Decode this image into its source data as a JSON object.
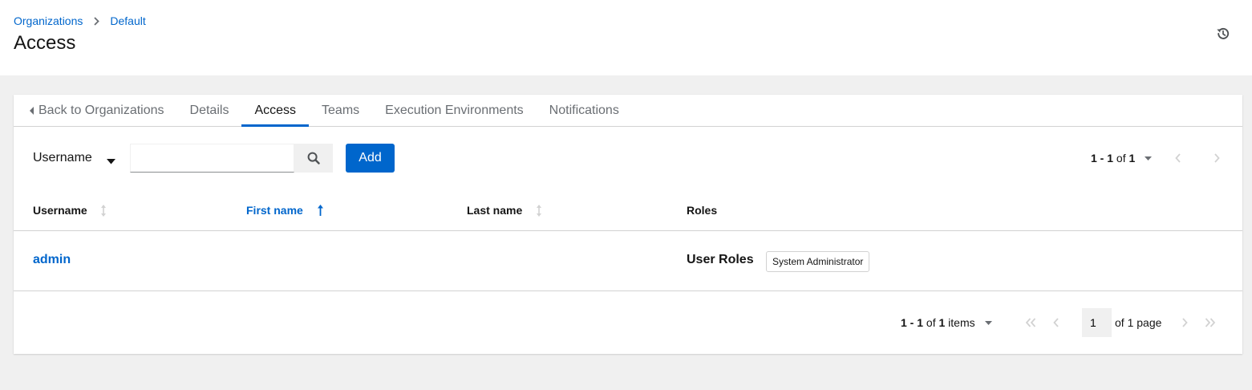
{
  "breadcrumb": [
    {
      "label": "Organizations"
    },
    {
      "label": "Default"
    }
  ],
  "page_title": "Access",
  "tabs": [
    {
      "label": "Back to Organizations"
    },
    {
      "label": "Details"
    },
    {
      "label": "Access"
    },
    {
      "label": "Teams"
    },
    {
      "label": "Execution Environments"
    },
    {
      "label": "Notifications"
    }
  ],
  "active_tab": "Access",
  "toolbar": {
    "filter_field": "Username",
    "search_value": "",
    "add_label": "Add"
  },
  "pagination_top": {
    "range": "1 - 1",
    "of": "of",
    "total": "1"
  },
  "table": {
    "columns": [
      {
        "label": "Username"
      },
      {
        "label": "First name"
      },
      {
        "label": "Last name"
      },
      {
        "label": "Roles"
      }
    ],
    "sorted_column": "First name",
    "rows": [
      {
        "username": "admin",
        "first_name": "",
        "last_name": "",
        "roles_label": "User Roles",
        "roles": [
          "System Administrator"
        ]
      }
    ]
  },
  "pagination_bottom": {
    "range": "1 - 1",
    "of": "of",
    "total": "1",
    "items_word": "items",
    "page_value": "1",
    "of_word": "of",
    "page_total": "1",
    "page_word": "page"
  },
  "colors": {
    "link": "#0066cc",
    "primary_button": "#0066cc",
    "muted_icon": "#d2d2d2",
    "page_bg": "#f0f0f0"
  },
  "icons": {
    "breadcrumb_separator": "angle-right-icon",
    "history": "history-icon",
    "back": "caret-left-icon",
    "filter_dropdown": "caret-down-icon",
    "search": "search-icon",
    "sort_unsorted": "arrows-alt-v-icon",
    "sort_asc": "long-arrow-up-icon",
    "first_page": "angle-double-left-icon",
    "previous_page": "angle-left-icon",
    "next_page": "angle-right-icon",
    "last_page": "angle-double-right-icon"
  }
}
